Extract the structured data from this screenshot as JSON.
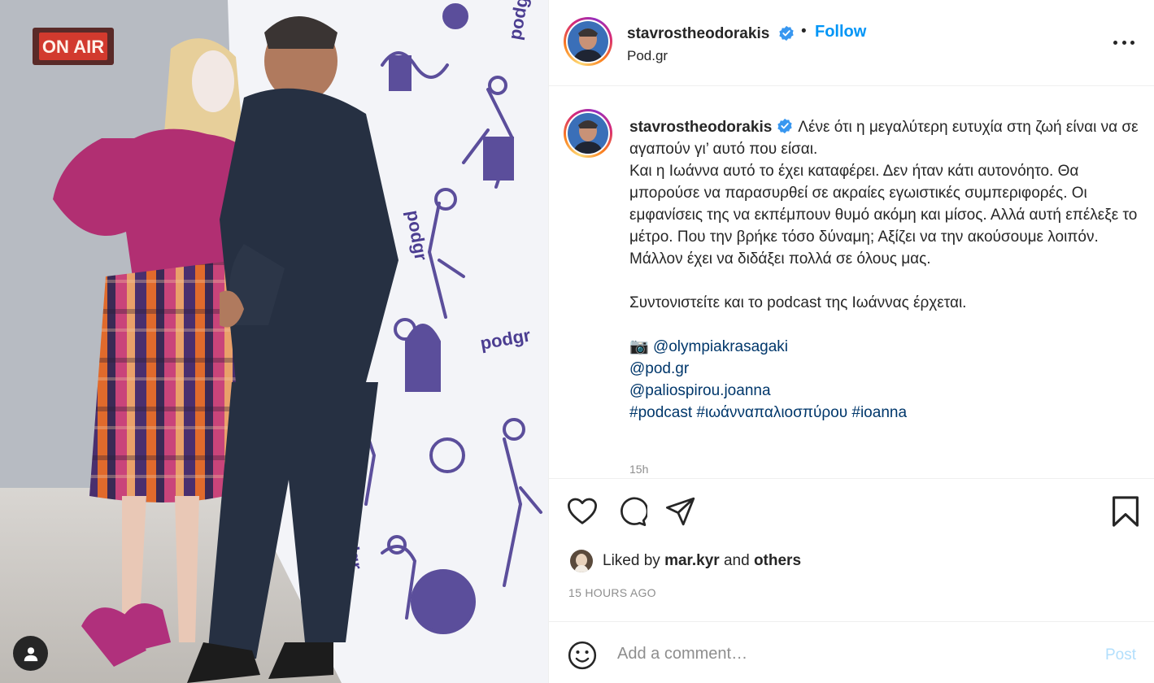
{
  "photo": {
    "sign_text": "ON AIR",
    "wall_brand": "podgr",
    "tag_icon": "user-icon"
  },
  "header": {
    "username": "stavrostheodorakis",
    "separator": "•",
    "follow_label": "Follow",
    "location": "Pod.gr"
  },
  "caption": {
    "username": "stavrostheodorakis",
    "lines": [
      "Λένε ότι η μεγαλύτερη ευτυχία στη ζωή είναι να σε αγαπούν γι’ αυτό που είσαι.",
      "Και η Ιωάννα αυτό το έχει καταφέρει. Δεν ήταν κάτι αυτονόητο. Θα μπορούσε να παρασυρθεί σε ακραίες εγωιστικές συμπεριφορές. Οι εμφανίσεις της να εκπέμπουν θυμό ακόμη και μίσος. Αλλά αυτή επέλεξε το μέτρο. Που την βρήκε τόσο δύναμη; Αξίζει να την ακούσουμε λοιπόν. Μάλλον έχει να διδάξει πολλά σε όλους μας.",
      "Συντονιστείτε και το podcast της Ιωάννας έρχεται."
    ],
    "camera_emoji": "📷",
    "mention_1": "@olympiakrasagaki",
    "mention_2": "@pod.gr",
    "mention_3": "@paliospirou.joanna",
    "hashtag_1": "#podcast",
    "hashtag_2": "#ιωάνναπαλιοσπύρου",
    "hashtag_3": "#ioanna",
    "time": "15h"
  },
  "actions": {
    "liked_by_prefix": "Liked by",
    "liked_by_user": "mar.kyr",
    "and_label": "and",
    "others_label": "others",
    "timestamp": "15 HOURS AGO"
  },
  "comment_box": {
    "placeholder": "Add a comment…",
    "post_label": "Post"
  },
  "colors": {
    "accent_blue": "#0095f6",
    "link_blue": "#00376b",
    "muted": "#8e8e8e",
    "post_disabled": "#b2dffc"
  }
}
